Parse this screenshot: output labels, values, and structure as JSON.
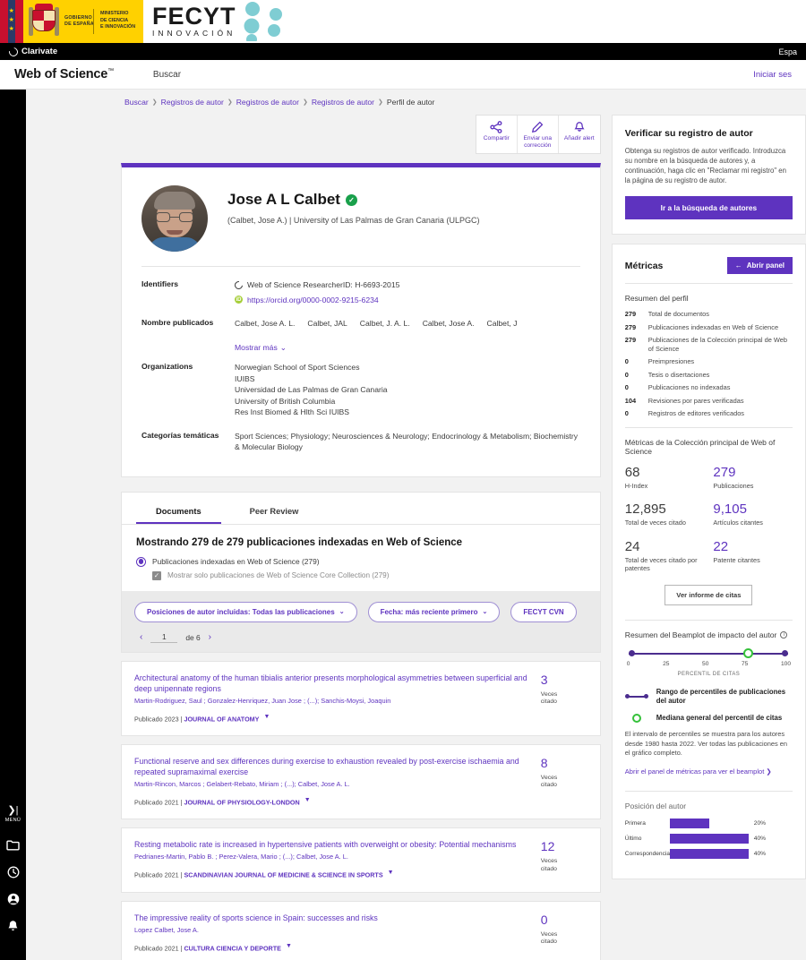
{
  "banner": {
    "gob_line1": "GOBIERNO",
    "gob_line2": "DE ESPAÑA",
    "min_line1": "MINISTERIO",
    "min_line2": "DE CIENCIA",
    "min_line3": "E INNOVACIÓN",
    "fecyt_name": "FECYT",
    "fecyt_tagline": "INNOVACIÓN"
  },
  "clarivate": {
    "brand": "Clarivate",
    "language": "Espa"
  },
  "header": {
    "product": "Web of Science",
    "trademark": "™",
    "nav_search": "Buscar",
    "signin": "Iniciar ses"
  },
  "breadcrumb": {
    "items": [
      "Buscar",
      "Registros de autor",
      "Registros de autor",
      "Registros de autor"
    ],
    "current": "Perfil de autor"
  },
  "toolbar": {
    "share": "Compartir",
    "correction": "Enviar una corrección",
    "alert": "Añadir alert"
  },
  "author": {
    "name": "Jose A L Calbet",
    "verified_badge": "verified-check",
    "affiliation": "(Calbet, Jose A.) | University of Las Palmas de Gran Canaria (ULPGC)",
    "labels": {
      "identifiers": "Identifiers",
      "published_names": "Nombre publicados",
      "organizations": "Organizations",
      "categories": "Categorías temáticas"
    },
    "researcher_id": "Web of Science ResearcherID: H-6693-2015",
    "orcid": "https://orcid.org/0000-0002-9215-6234",
    "published_names": [
      "Calbet, Jose A. L.",
      "Calbet, JAL",
      "Calbet, J. A. L.",
      "Calbet, Jose A.",
      "Calbet, J"
    ],
    "show_more": "Mostrar más",
    "organizations": [
      "Norwegian School of Sport Sciences",
      "IUIBS",
      "Universidad de Las Palmas de Gran Canaria",
      "University of British Columbia",
      "Res Inst Biomed & Hlth Sci IUIBS"
    ],
    "categories": "Sport Sciences;  Physiology;  Neurosciences & Neurology;  Endocrinology & Metabolism;  Biochemistry & Molecular Biology"
  },
  "documents": {
    "tabs": [
      {
        "label": "Documents",
        "active": true
      },
      {
        "label": "Peer Review",
        "active": false
      }
    ],
    "showing": "Mostrando 279 de 279 publicaciones indexadas en Web of Science",
    "radio_label": "Publicaciones indexadas en Web of Science (279)",
    "checkbox_label": "Mostrar solo publicaciones de Web of Science Core Collection (279)",
    "filter_positions": "Posiciones de autor incluidas:  Todas las publicaciones",
    "filter_date": "Fecha: más reciente primero",
    "filter_cvn": "FECYT CVN",
    "pager": {
      "current": "1",
      "of": "de 6"
    },
    "cited_label_line1": "Veces",
    "cited_label_line2": "citado",
    "published_prefix": "Publicado",
    "items": [
      {
        "title": "Architectural anatomy of the human tibialis anterior presents morphological asymmetries between superficial and deep unipennate regions",
        "authors": "Martin-Rodriguez, Saul ; Gonzalez-Henriquez, Juan Jose ; (...); Sanchis-Moysi, Joaquin",
        "year": "2023",
        "journal": "JOURNAL OF ANATOMY",
        "citations": "3"
      },
      {
        "title": "Functional reserve and sex differences during exercise to exhaustion revealed by post-exercise ischaemia and repeated supramaximal exercise",
        "authors": "Martin-Rincon, Marcos ; Gelabert-Rebato, Miriam ; (...); Calbet, Jose A. L.",
        "year": "2021",
        "journal": "JOURNAL OF PHYSIOLOGY-LONDON",
        "citations": "8"
      },
      {
        "title": "Resting metabolic rate is increased in hypertensive patients with overweight or obesity: Potential mechanisms",
        "authors": "Pedrianes-Martin, Pablo B. ; Perez-Valera, Mario ; (...); Calbet, Jose A. L.",
        "year": "2021",
        "journal": "SCANDINAVIAN JOURNAL OF MEDICINE & SCIENCE IN SPORTS",
        "citations": "12"
      },
      {
        "title": "The impressive reality of sports science in Spain: successes and risks",
        "authors": "Lopez Calbet, Jose A.",
        "year": "2021",
        "journal": "CULTURA CIENCIA Y DEPORTE",
        "citations": "0"
      }
    ]
  },
  "sidebar": {
    "verify": {
      "title": "Verificar su registro de autor",
      "body": "Obtenga su registros de autor verificado. Introduzca su nombre en la búsqueda de autores y, a continuación, haga clic en \"Reclamar mi registro\" en la página de su registro de autor.",
      "button": "Ir a la búsqueda de autores"
    },
    "metrics": {
      "title": "Métricas",
      "open_panel": "Abrir panel",
      "profile_summary_title": "Resumen del perfil",
      "summary_rows": [
        {
          "value": "279",
          "label": "Total de documentos"
        },
        {
          "value": "279",
          "label": "Publicaciones indexadas en Web of Science"
        },
        {
          "value": "279",
          "label": "Publicaciones de la Colección principal de Web of Science"
        },
        {
          "value": "0",
          "label": "Preimpresiones"
        },
        {
          "value": "0",
          "label": "Tesis o disertaciones"
        },
        {
          "value": "0",
          "label": "Publicaciones no indexadas"
        },
        {
          "value": "104",
          "label": "Revisiones por pares verificadas"
        },
        {
          "value": "0",
          "label": "Registros de editores verificados"
        }
      ],
      "core_title": "Métricas de la Colección principal de Web of Science",
      "core_cells": [
        {
          "value": "68",
          "label": "H-Index",
          "purple": false
        },
        {
          "value": "279",
          "label": "Publicaciones",
          "purple": true
        },
        {
          "value": "12,895",
          "label": "Total de veces citado",
          "purple": false
        },
        {
          "value": "9,105",
          "label": "Artículos citantes",
          "purple": true
        },
        {
          "value": "24",
          "label": "Total de veces citado por patentes",
          "purple": false
        },
        {
          "value": "22",
          "label": "Patente citantes",
          "purple": true
        }
      ],
      "citation_report_button": "Ver informe de citas"
    },
    "beamplot": {
      "title": "Resumen del Beamplot de impacto del autor",
      "axis_label": "PERCENTIL DE CITAS",
      "ticks": [
        "0",
        "25",
        "50",
        "75",
        "100"
      ],
      "legend_range": "Rango de percentiles de publicaciones del autor",
      "legend_median": "Mediana general del percentil de citas",
      "note": "El intervalo de percentiles se muestra para los autores desde 1980 hasta 2022. Ver todas las publicaciones en el gráfico completo.",
      "link": "Abrir el panel de métricas para ver el beamplot  ❯"
    },
    "author_position": {
      "title": "Posición del autor",
      "rows": [
        {
          "label": "Primera",
          "pct": "20%",
          "value": 20
        },
        {
          "label": "Último",
          "pct": "40%",
          "value": 40
        },
        {
          "label": "Correspondencia",
          "pct": "40%",
          "value": 40
        }
      ]
    }
  },
  "rail": {
    "menu_label": "MENÚ",
    "icons": [
      "expand-menu-icon",
      "folder-icon",
      "history-icon",
      "profile-icon",
      "bell-icon"
    ]
  },
  "chart_data": {
    "type": "bar",
    "title": "Posición del autor",
    "categories": [
      "Primera",
      "Último",
      "Correspondencia"
    ],
    "values": [
      20,
      40,
      40
    ],
    "xlabel": "",
    "ylabel": "",
    "xlim": [
      0,
      100
    ],
    "unit": "%",
    "orientation": "horizontal",
    "bar_color": "#5e33bf"
  }
}
